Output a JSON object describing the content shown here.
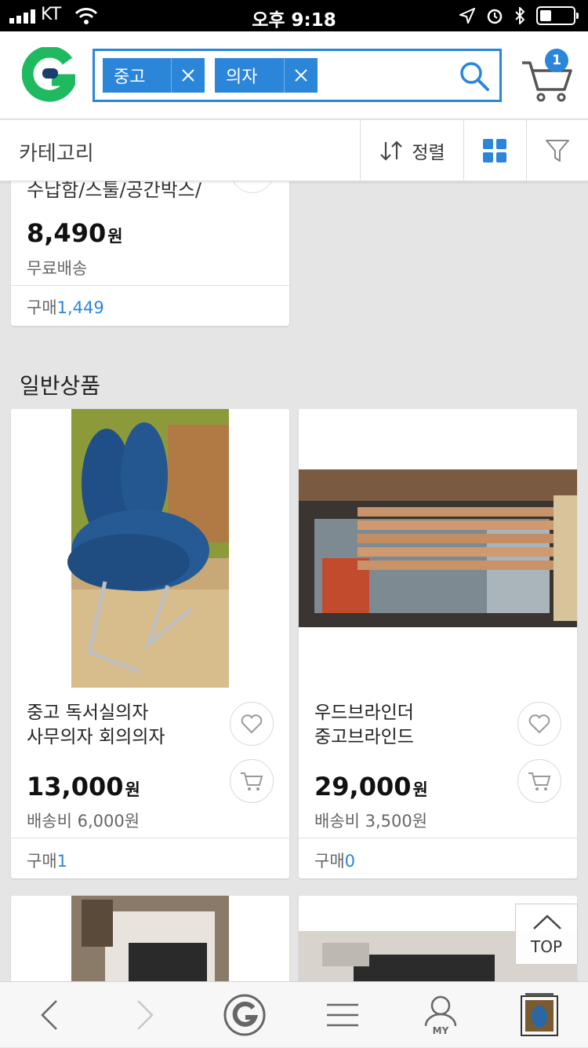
{
  "status_bar": {
    "carrier": "KT",
    "time": "오후 9:18"
  },
  "header": {
    "logo_letter": "G",
    "search_chips": [
      {
        "label": "중고"
      },
      {
        "label": "의자"
      }
    ],
    "cart_count": "1"
  },
  "filter_bar": {
    "category_label": "카테고리",
    "sort_label": "정렬"
  },
  "top_card": {
    "title_cut": "수납함/스툴/공간박스/",
    "price": "8,490",
    "currency": "원",
    "shipping": "무료배송",
    "buy_label": "구매",
    "buy_count": "1,449"
  },
  "section": {
    "title": "일반상품"
  },
  "products": [
    {
      "name_line1": "중고 독서실의자",
      "name_line2": "사무의자 회의의자",
      "price": "13,000",
      "currency": "원",
      "shipping": "배송비 6,000원",
      "buy_label": "구매",
      "buy_count": "1"
    },
    {
      "name_line1": "우드브라인더",
      "name_line2": "중고브라인드",
      "price": "29,000",
      "currency": "원",
      "shipping": "배송비 3,500원",
      "buy_label": "구매",
      "buy_count": "0"
    }
  ],
  "top_button": {
    "label": "TOP"
  },
  "tab_bar": {
    "my_label": "MY"
  },
  "colors": {
    "accent": "#2b86d9",
    "logo_green": "#1fba5f"
  }
}
